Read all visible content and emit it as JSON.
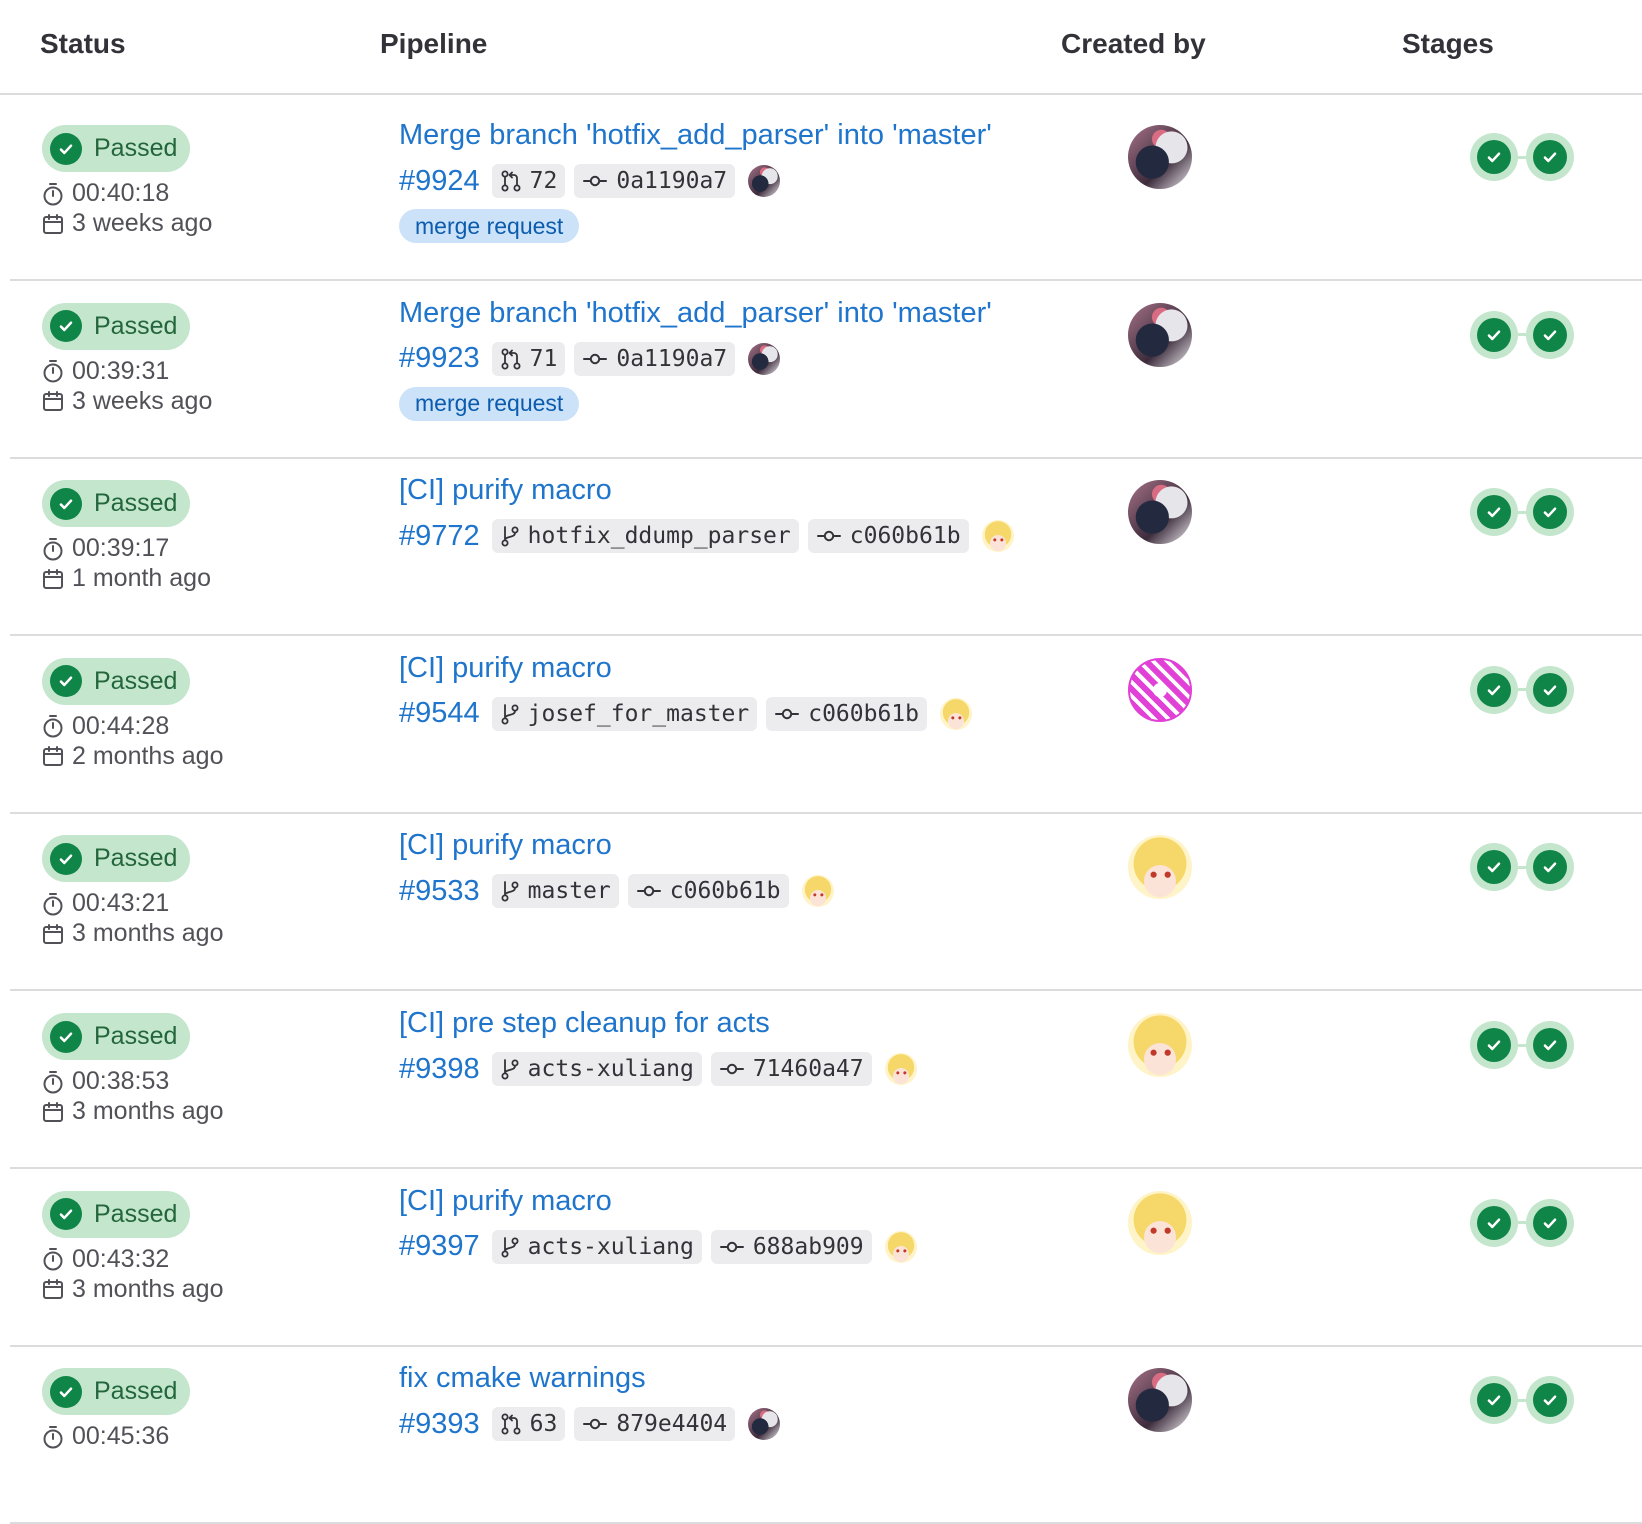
{
  "columns": {
    "status": "Status",
    "pipeline": "Pipeline",
    "created_by": "Created by",
    "stages": "Stages"
  },
  "colors": {
    "success": "#108548",
    "success_bg": "#c3e6cd",
    "link": "#1f75cb",
    "tag_bg": "#cbe2f9"
  },
  "rows": [
    {
      "status": "Passed",
      "duration": "00:40:18",
      "finished": "3 weeks ago",
      "title": "Merge branch 'hotfix_add_parser' into 'master'",
      "id": "#9924",
      "ref_type": "merge-request-icon",
      "ref": "72",
      "commit": "0a1190a7",
      "tag": "merge request",
      "author_avatar": "dark",
      "mini_avatar": "dark",
      "stages": [
        "passed",
        "passed"
      ]
    },
    {
      "status": "Passed",
      "duration": "00:39:31",
      "finished": "3 weeks ago",
      "title": "Merge branch 'hotfix_add_parser' into 'master'",
      "id": "#9923",
      "ref_type": "merge-request-icon",
      "ref": "71",
      "commit": "0a1190a7",
      "tag": "merge request",
      "author_avatar": "dark",
      "mini_avatar": "dark",
      "stages": [
        "passed",
        "passed"
      ]
    },
    {
      "status": "Passed",
      "duration": "00:39:17",
      "finished": "1 month ago",
      "title": "[CI] purify macro",
      "id": "#9772",
      "ref_type": "branch-icon",
      "ref": "hotfix_ddump_parser",
      "commit": "c060b61b",
      "tag": "",
      "author_avatar": "dark",
      "mini_avatar": "blonde",
      "stages": [
        "passed",
        "passed"
      ]
    },
    {
      "status": "Passed",
      "duration": "00:44:28",
      "finished": "2 months ago",
      "title": "[CI] purify macro",
      "id": "#9544",
      "ref_type": "branch-icon",
      "ref": "josef_for_master",
      "commit": "c060b61b",
      "tag": "",
      "author_avatar": "pink",
      "mini_avatar": "blonde",
      "stages": [
        "passed",
        "passed"
      ]
    },
    {
      "status": "Passed",
      "duration": "00:43:21",
      "finished": "3 months ago",
      "title": "[CI] purify macro",
      "id": "#9533",
      "ref_type": "branch-icon",
      "ref": "master",
      "commit": "c060b61b",
      "tag": "",
      "author_avatar": "blonde",
      "mini_avatar": "blonde",
      "stages": [
        "passed",
        "passed"
      ]
    },
    {
      "status": "Passed",
      "duration": "00:38:53",
      "finished": "3 months ago",
      "title": "[CI] pre step cleanup for acts",
      "id": "#9398",
      "ref_type": "branch-icon",
      "ref": "acts-xuliang",
      "commit": "71460a47",
      "tag": "",
      "author_avatar": "blonde",
      "mini_avatar": "blonde",
      "stages": [
        "passed",
        "passed"
      ]
    },
    {
      "status": "Passed",
      "duration": "00:43:32",
      "finished": "3 months ago",
      "title": "[CI] purify macro",
      "id": "#9397",
      "ref_type": "branch-icon",
      "ref": "acts-xuliang",
      "commit": "688ab909",
      "tag": "",
      "author_avatar": "blonde",
      "mini_avatar": "blonde",
      "stages": [
        "passed",
        "passed"
      ]
    },
    {
      "status": "Passed",
      "duration": "00:45:36",
      "finished": "",
      "title": "fix cmake warnings",
      "id": "#9393",
      "ref_type": "merge-request-icon",
      "ref": "63",
      "commit": "879e4404",
      "tag": "",
      "author_avatar": "dark",
      "mini_avatar": "dark",
      "stages": [
        "passed",
        "passed"
      ]
    }
  ]
}
